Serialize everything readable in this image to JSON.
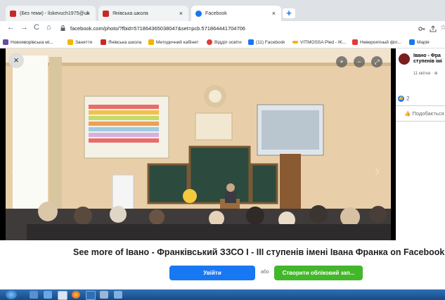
{
  "tabs": [
    {
      "label": "(Без теми) - liskevuch1975@uk",
      "close": "×",
      "color": "#c62828"
    },
    {
      "label": "Янівська школа",
      "close": "×",
      "color": "#c62828"
    },
    {
      "label": "Facebook",
      "close": "×",
      "color": "#1877f2"
    }
  ],
  "new_tab": "+",
  "nav": {
    "back": "←",
    "forward": "→",
    "reload": "C",
    "home": "⌂"
  },
  "address": {
    "url": "facebook.com/photo/?fbid=571864365038047&set=pcb.571864441704706"
  },
  "bookmarks": [
    {
      "label": "Новояворівська мі...",
      "color": "#6a4c9c"
    },
    {
      "label": "Заняття",
      "color": "#f4b400"
    },
    {
      "label": "Янівська школа",
      "color": "#c62828"
    },
    {
      "label": "Методичний кабінет",
      "color": "#f4b400"
    },
    {
      "label": "Відділ освіти",
      "color": "#e53935"
    },
    {
      "label": "(11) Facebook",
      "color": "#1877f2"
    },
    {
      "label": "VITMOSSA Pled - IK...",
      "color": "#f4b400"
    },
    {
      "label": "Невероятный філ...",
      "color": "#e53935"
    },
    {
      "label": "Марія",
      "color": "#1877f2"
    }
  ],
  "viewer": {
    "close": "×",
    "zoom_in": "+",
    "zoom_out": "−",
    "expand": "⤢",
    "prev": "‹",
    "next": "›"
  },
  "post": {
    "author": "Івано - Фра... ступенів імі...",
    "author_line1": "Івано - Фра",
    "author_line2": "ступенів імі",
    "date": "11 квітня · ⊕",
    "like_count": "2",
    "like_button": "Подобається"
  },
  "banner": {
    "see_more": "See more of Івано - Франківський ЗЗСО І - ІІІ ступенів імені Івана Франка on Facebook",
    "login": "Увійти",
    "or": "або",
    "create": "Створити обліковий зап..."
  },
  "colors": {
    "facebook_blue": "#1877f2",
    "create_green": "#42b72a",
    "taskbar": "#2f6fb5"
  }
}
